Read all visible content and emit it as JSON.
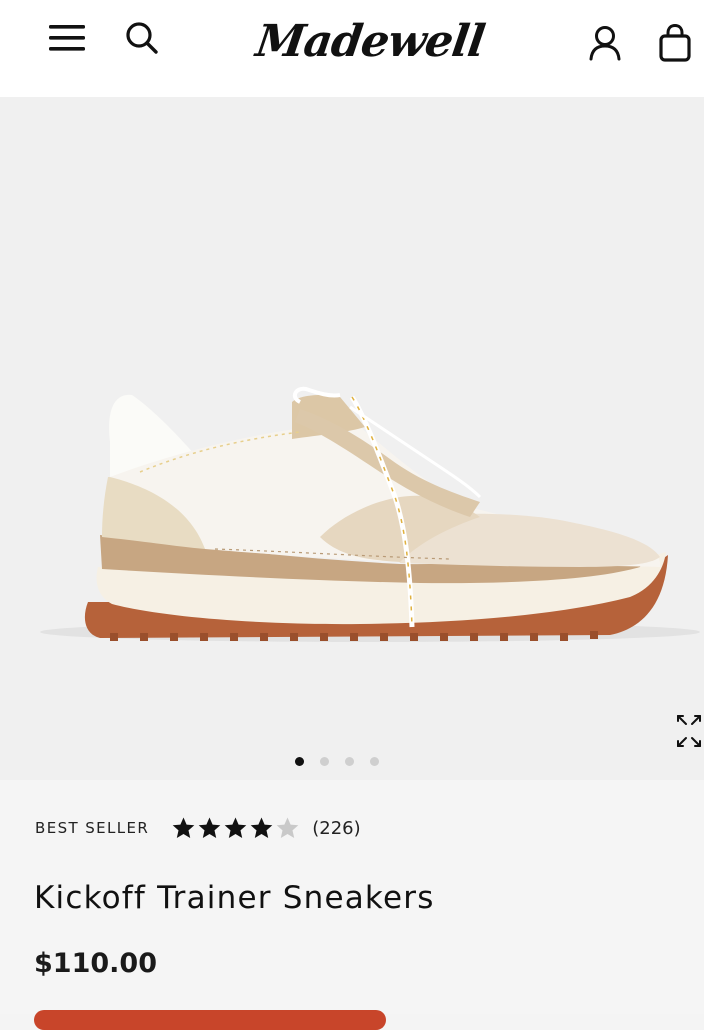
{
  "header": {
    "logo_text": "Madewell",
    "icons": [
      "menu-icon",
      "search-icon",
      "account-icon",
      "bag-icon"
    ]
  },
  "gallery": {
    "image_name": "kickoff-trainer-sneaker-side-view",
    "slide_count": 4,
    "active_slide": 1
  },
  "product": {
    "badge": "BEST SELLER",
    "rating": 4.0,
    "rating_max": 5,
    "review_count": "(226)",
    "title": "Kickoff Trainer Sneakers",
    "price": "$110.00"
  },
  "colors": {
    "accent": "#c8452a",
    "star": "#111111",
    "star_empty": "#c9c9c9"
  }
}
